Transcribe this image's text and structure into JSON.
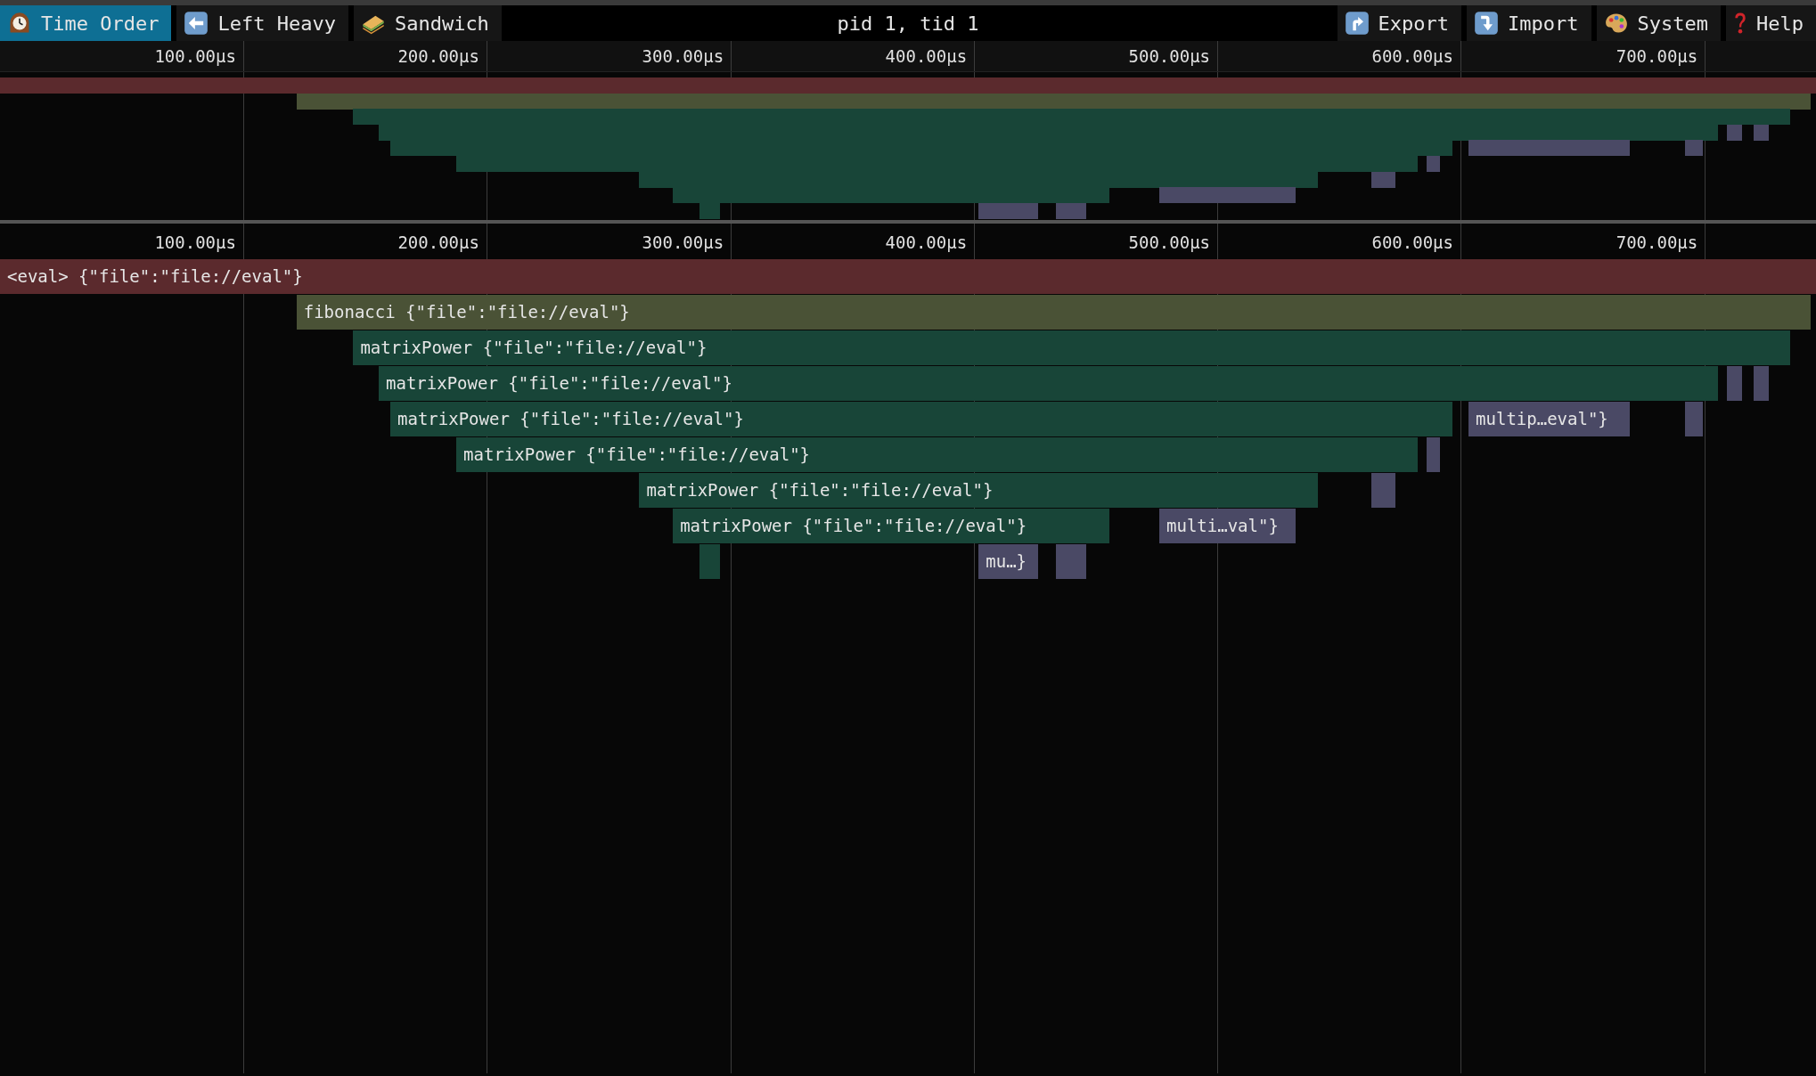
{
  "toolbar": {
    "view_tabs": [
      {
        "label": "Time Order",
        "selected": true,
        "kind": "time"
      },
      {
        "label": "Left Heavy",
        "selected": false,
        "kind": "left"
      },
      {
        "label": "Sandwich",
        "selected": false,
        "kind": "sandwich"
      }
    ],
    "title": "pid 1, tid 1",
    "actions": [
      {
        "label": "Export",
        "kind": "export"
      },
      {
        "label": "Import",
        "kind": "import"
      },
      {
        "label": "System",
        "kind": "theme"
      },
      {
        "label": "Help",
        "kind": "help"
      }
    ]
  },
  "minimap": {
    "ticks": [
      "100.00µs",
      "200.00µs",
      "300.00µs",
      "400.00µs",
      "500.00µs",
      "600.00µs",
      "700.00µs"
    ]
  },
  "flamechart": {
    "ticks": [
      "100.00µs",
      "200.00µs",
      "300.00µs",
      "400.00µs",
      "500.00µs",
      "600.00µs",
      "700.00µs"
    ],
    "frames": [
      {
        "label": "<eval> {\"file\":\"file://eval\"}",
        "color": "#5b2a2d"
      },
      {
        "label": "fibonacci {\"file\":\"file://eval\"}",
        "color": "#4a5236"
      },
      {
        "label": "matrixPower {\"file\":\"file://eval\"}",
        "color": "#184538"
      },
      {
        "label": "matrixPower {\"file\":\"file://eval\"}",
        "color": "#184538"
      },
      {
        "label": "matrixPower {\"file\":\"file://eval\"}",
        "color": "#184538"
      },
      {
        "label": "multip…eval\"}",
        "color": "#4a4965"
      },
      {
        "label": "matrixPower {\"file\":\"file://eval\"}",
        "color": "#184538"
      },
      {
        "label": "matrixPower {\"file\":\"file://eval\"}",
        "color": "#184538"
      },
      {
        "label": "matrixPower {\"file\":\"file://eval\"}",
        "color": "#184538"
      },
      {
        "label": "multi…val\"}",
        "color": "#4a4965"
      },
      {
        "label": "mu…}",
        "color": "#4a4965"
      }
    ]
  }
}
